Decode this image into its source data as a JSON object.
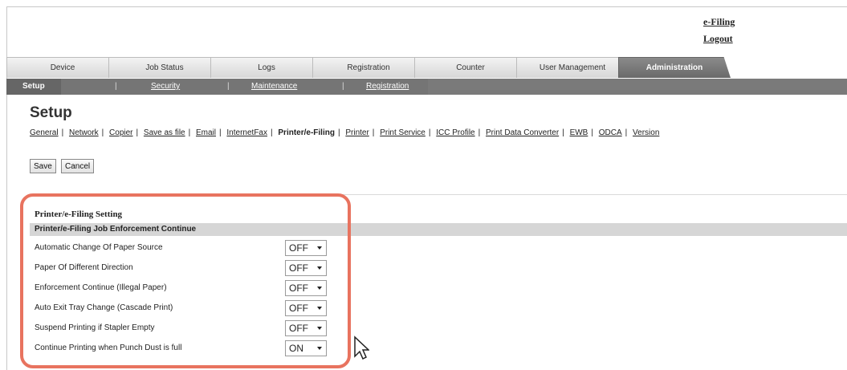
{
  "top_links": {
    "efiling": "e-Filing",
    "logout": "Logout"
  },
  "tabs": [
    {
      "label": "Device"
    },
    {
      "label": "Job Status"
    },
    {
      "label": "Logs"
    },
    {
      "label": "Registration"
    },
    {
      "label": "Counter"
    },
    {
      "label": "User Management"
    },
    {
      "label": "Administration"
    }
  ],
  "subnav": [
    {
      "label": "Setup"
    },
    {
      "label": "Security"
    },
    {
      "label": "Maintenance"
    },
    {
      "label": "Registration"
    }
  ],
  "page": {
    "title": "Setup"
  },
  "setup_menu": [
    "General",
    "Network",
    "Copier",
    "Save as file",
    "Email",
    "InternetFax",
    "Printer/e-Filing",
    "Printer",
    "Print Service",
    "ICC Profile",
    "Print Data Converter",
    "EWB",
    "ODCA",
    "Version"
  ],
  "buttons": {
    "save": "Save",
    "cancel": "Cancel"
  },
  "section": {
    "title": "Printer/e-Filing Setting",
    "subheading": "Printer/e-Filing Job Enforcement Continue",
    "settings": [
      {
        "label": "Automatic Change Of Paper Source",
        "value": "OFF"
      },
      {
        "label": "Paper Of Different Direction",
        "value": "OFF"
      },
      {
        "label": "Enforcement Continue (Illegal Paper)",
        "value": "OFF"
      },
      {
        "label": "Auto Exit Tray Change (Cascade Print)",
        "value": "OFF"
      },
      {
        "label": "Suspend Printing if Stapler Empty",
        "value": "OFF"
      },
      {
        "label": "Continue Printing when Punch Dust is full",
        "value": "ON"
      }
    ]
  },
  "highlight_color": "#e8735f"
}
